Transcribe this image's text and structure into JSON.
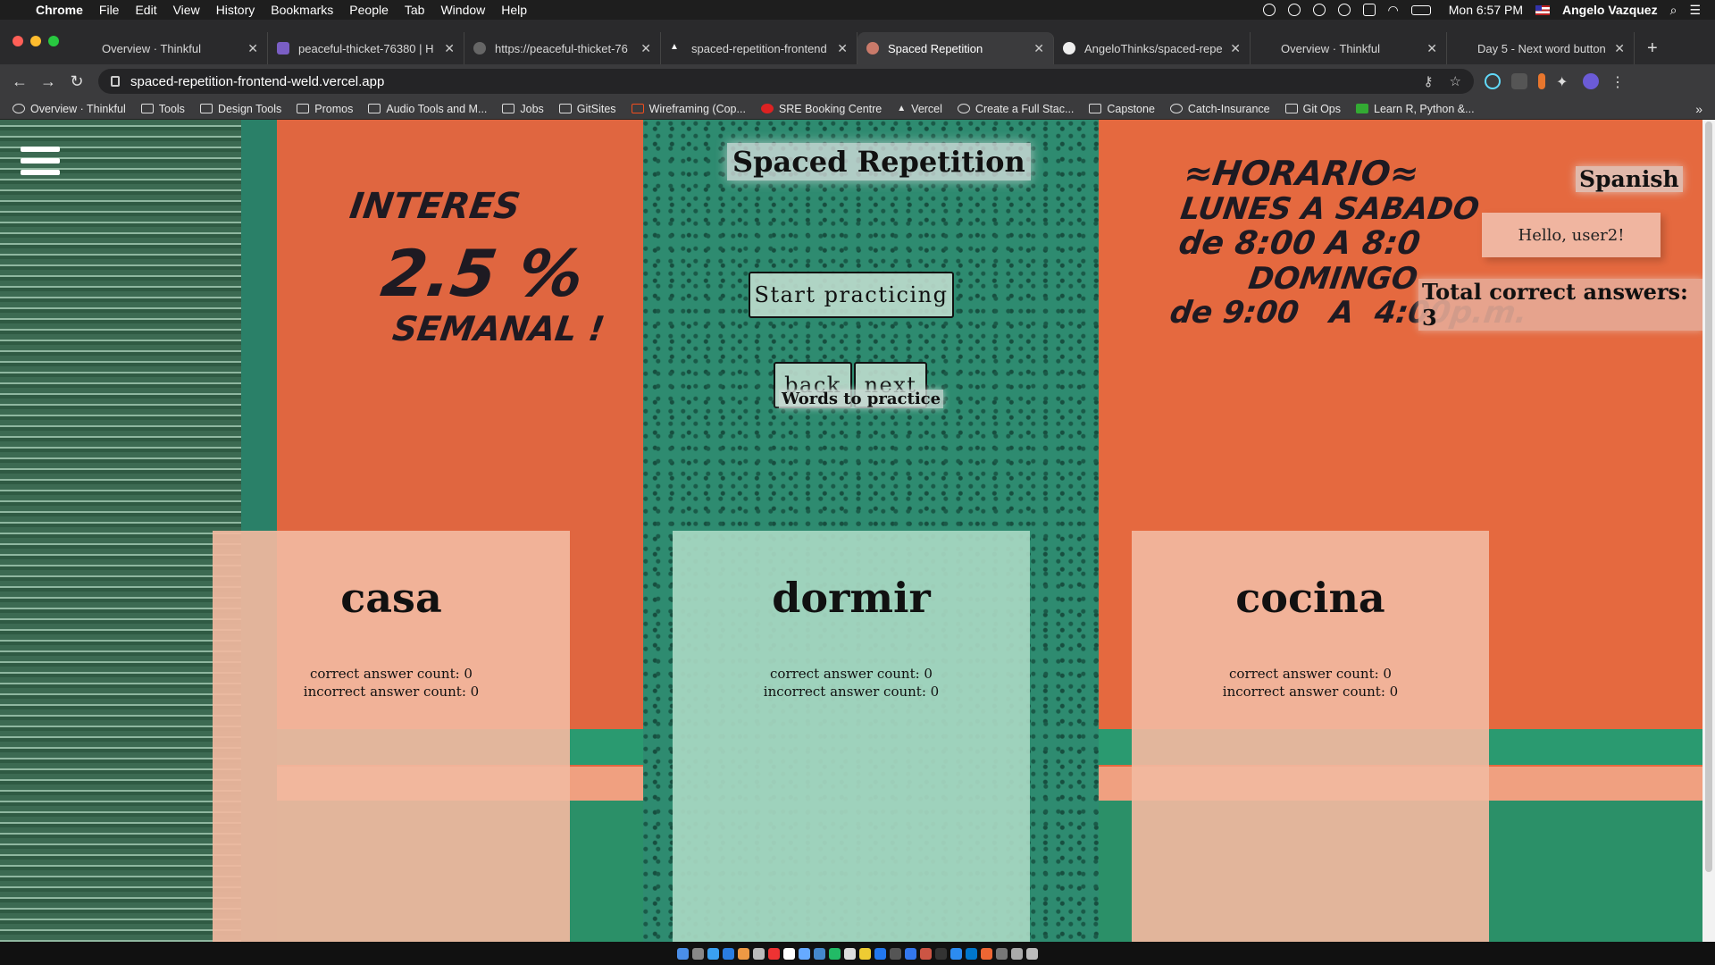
{
  "menubar": {
    "app_name": "Chrome",
    "items": [
      "File",
      "Edit",
      "View",
      "History",
      "Bookmarks",
      "People",
      "Tab",
      "Window",
      "Help"
    ],
    "clock": "Mon 6:57 PM",
    "user": "Angelo Vazquez"
  },
  "tabs": [
    {
      "title": "Overview · Thinkful"
    },
    {
      "title": "peaceful-thicket-76380 | H"
    },
    {
      "title": "https://peaceful-thicket-76"
    },
    {
      "title": "spaced-repetition-frontend"
    },
    {
      "title": "Spaced Repetition"
    },
    {
      "title": "AngeloThinks/spaced-repe"
    },
    {
      "title": "Overview · Thinkful"
    },
    {
      "title": "Day 5 - Next word button |"
    }
  ],
  "active_tab_index": 4,
  "address_bar": {
    "url": "spaced-repetition-frontend-weld.vercel.app"
  },
  "bookmarks": [
    "Overview · Thinkful",
    "Tools",
    "Design Tools",
    "Promos",
    "Audio Tools and M...",
    "Jobs",
    "GitSites",
    "Wireframing (Cop...",
    "SRE Booking Centre",
    "Vercel",
    "Create a Full Stac...",
    "Capstone",
    "Catch-Insurance",
    "Git Ops",
    "Learn R, Python &..."
  ],
  "background_signs": {
    "left_sign": [
      "INTERES",
      "2.5 %",
      "SEMANAL !"
    ],
    "right_sign": [
      "≈HORARIO≈",
      "LUNES A SABADO",
      "de 8:00 A 8:0",
      "DOMINGO",
      "de 9:00   A  4:00p.m."
    ]
  },
  "app": {
    "title": "Spaced Repetition",
    "language": "Spanish",
    "greeting": "Hello, user2!",
    "total_correct": "Total correct answers: 3",
    "start_button": "Start practicing",
    "back_button": "back",
    "next_button": "next",
    "words_label": "Words to practice",
    "words": [
      {
        "word": "casa",
        "correct": "correct answer count: 0",
        "incorrect": "incorrect answer count: 0"
      },
      {
        "word": "dormir",
        "correct": "correct answer count: 0",
        "incorrect": "incorrect answer count: 0"
      },
      {
        "word": "cocina",
        "correct": "correct answer count: 0",
        "incorrect": "incorrect answer count: 0"
      }
    ]
  },
  "colors": {
    "card_peach": "#f2b8a0",
    "card_mint": "#a8d8c2",
    "accent_orange": "#e06640",
    "door_green": "#2e8b70"
  }
}
